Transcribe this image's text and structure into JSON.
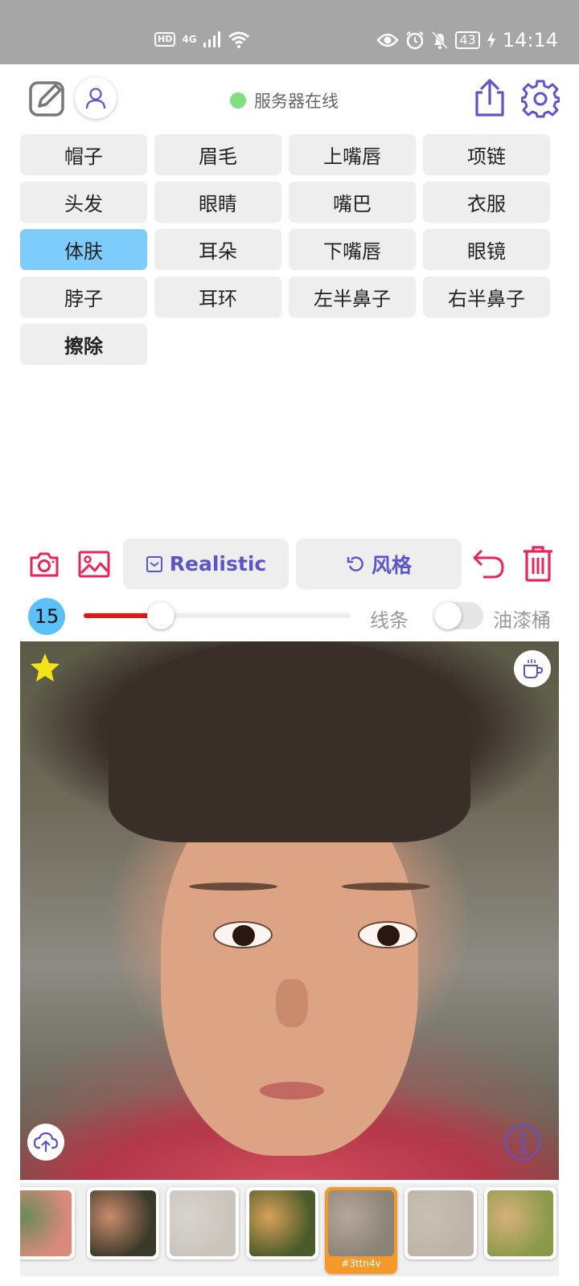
{
  "status_bar": {
    "network": "4G",
    "hd_label": "HD",
    "battery": "43",
    "time": "14:14"
  },
  "header": {
    "server_status": "服务器在线",
    "server_status_color": "#7ee081"
  },
  "parts": [
    {
      "label": "帽子",
      "active": false
    },
    {
      "label": "眉毛",
      "active": false
    },
    {
      "label": "上嘴唇",
      "active": false
    },
    {
      "label": "项链",
      "active": false
    },
    {
      "label": "头发",
      "active": false
    },
    {
      "label": "眼睛",
      "active": false
    },
    {
      "label": "嘴巴",
      "active": false
    },
    {
      "label": "衣服",
      "active": false
    },
    {
      "label": "体肤",
      "active": true
    },
    {
      "label": "耳朵",
      "active": false
    },
    {
      "label": "下嘴唇",
      "active": false
    },
    {
      "label": "眼镜",
      "active": false
    },
    {
      "label": "脖子",
      "active": false
    },
    {
      "label": "耳环",
      "active": false
    },
    {
      "label": "左半鼻子",
      "active": false
    },
    {
      "label": "右半鼻子",
      "active": false
    },
    {
      "label": "擦除",
      "active": false
    }
  ],
  "toolbar": {
    "model_label": "Realistic",
    "style_label": "风格",
    "accent_color": "#5c55c9",
    "action_color": "#e8245a"
  },
  "brush": {
    "size": "15",
    "size_fraction": 0.29,
    "line_label": "线条",
    "bucket_label": "油漆桶",
    "bucket_enabled": false,
    "active_color": "#e31717",
    "badge_color": "#5cc0fa"
  },
  "gallery": {
    "selected_tag": "#3ttn4v",
    "selected_color": "#f59a2a",
    "items": [
      {
        "colors": [
          "#d98a7a",
          "#6b8a5a"
        ]
      },
      {
        "colors": [
          "#3a3a2a",
          "#c98a6a"
        ]
      },
      {
        "colors": [
          "#c9c4bc",
          "#d8d3cc"
        ]
      },
      {
        "colors": [
          "#4a5a2a",
          "#d8a05a"
        ]
      },
      {
        "colors": [
          "#8a8478",
          "#b9a59a"
        ]
      },
      {
        "colors": [
          "#bdb4a8",
          "#c9c0b4"
        ]
      },
      {
        "colors": [
          "#8a9a4a",
          "#d8b07a"
        ]
      }
    ]
  }
}
